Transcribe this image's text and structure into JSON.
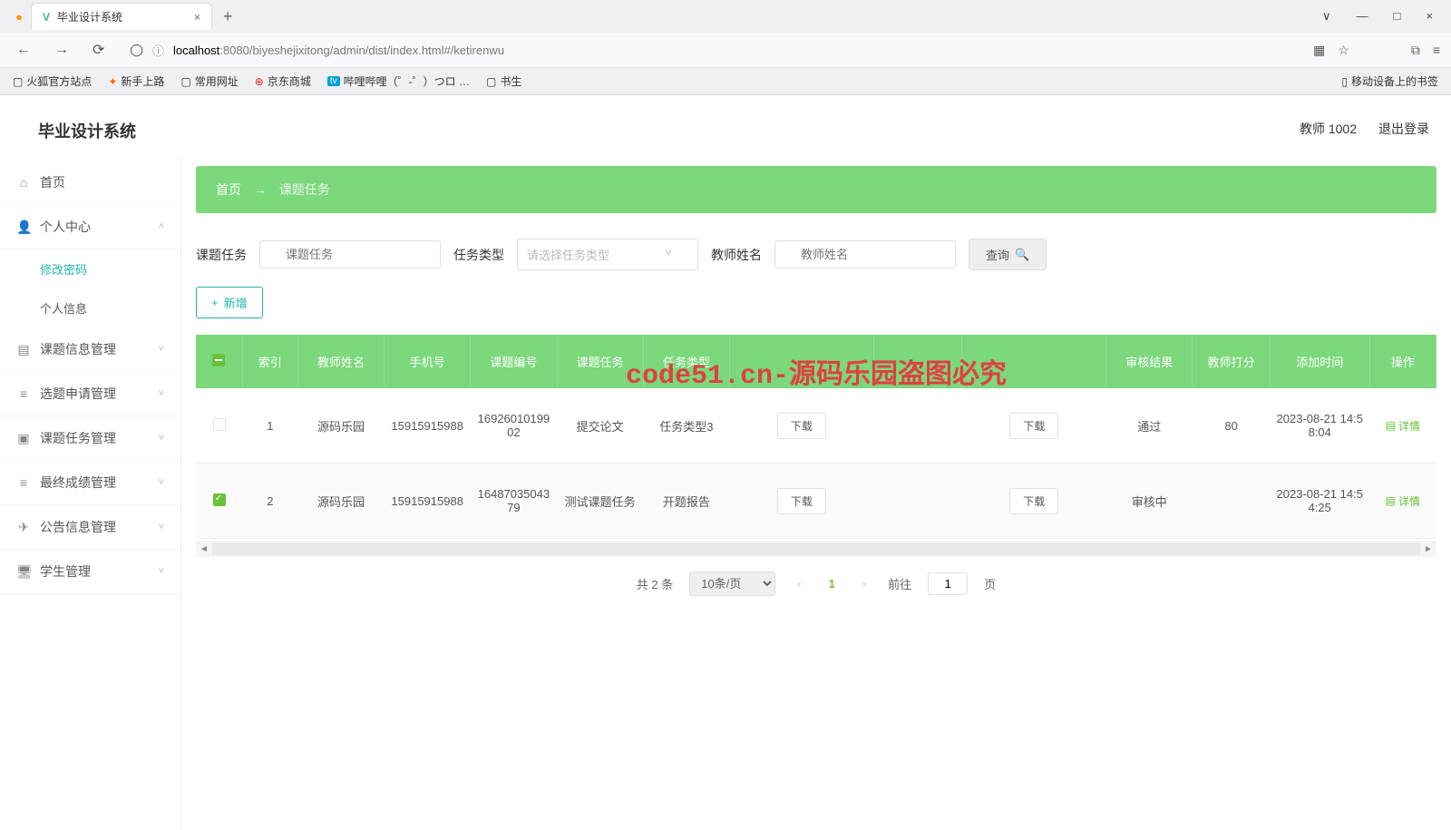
{
  "browser": {
    "tab_title": "毕业设计系统",
    "url_host": "localhost",
    "url_port": ":8080",
    "url_path": "/biyeshejixitong/admin/dist/index.html#/ketirenwu",
    "bookmarks": [
      "火狐官方站点",
      "新手上路",
      "常用网址",
      "京东商城",
      "哔哩哔哩（゜-゜）つロ …",
      "书生"
    ],
    "mobile_bm": "移动设备上的书签"
  },
  "app": {
    "title": "毕业设计系统",
    "user": "教师 1002",
    "logout": "退出登录"
  },
  "sidebar": {
    "home": "首页",
    "personal": "个人中心",
    "sub_pwd": "修改密码",
    "sub_info": "个人信息",
    "ketiinfo": "课题信息管理",
    "xuanti": "选题申请管理",
    "ketirenwu": "课题任务管理",
    "chengji": "最终成绩管理",
    "gonggao": "公告信息管理",
    "xuesheng": "学生管理"
  },
  "breadcrumb": {
    "home": "首页",
    "current": "课题任务"
  },
  "filters": {
    "f1_label": "课题任务",
    "f1_ph": "课题任务",
    "f2_label": "任务类型",
    "f2_ph": "请选择任务类型",
    "f3_label": "教师姓名",
    "f3_ph": "教师姓名",
    "query": "查询"
  },
  "actions": {
    "add": "新增",
    "download": "下载",
    "detail": "详情"
  },
  "table": {
    "headers": [
      "",
      "索引",
      "教师姓名",
      "手机号",
      "课题编号",
      "课题任务",
      "任务类型",
      "",
      "",
      "",
      "审核结果",
      "教师打分",
      "添加时间",
      "操作"
    ],
    "rows": [
      {
        "checked": false,
        "idx": "1",
        "teacher": "源码乐园",
        "phone": "15915915988",
        "code": "1692601019902",
        "task": "提交论文",
        "type": "任务类型3",
        "result": "通过",
        "score": "80",
        "time": "2023-08-21 14:58:04"
      },
      {
        "checked": true,
        "idx": "2",
        "teacher": "源码乐园",
        "phone": "15915915988",
        "code": "1648703504379",
        "task": "测试课题任务",
        "type": "开题报告",
        "result": "审核中",
        "score": "",
        "time": "2023-08-21 14:54:25"
      }
    ]
  },
  "pagination": {
    "total": "共 2 条",
    "perpage": "10条/页",
    "current": "1",
    "goto_pre": "前往",
    "goto_val": "1",
    "goto_suf": "页"
  },
  "overlay": "code51.cn-源码乐园盗图必究"
}
